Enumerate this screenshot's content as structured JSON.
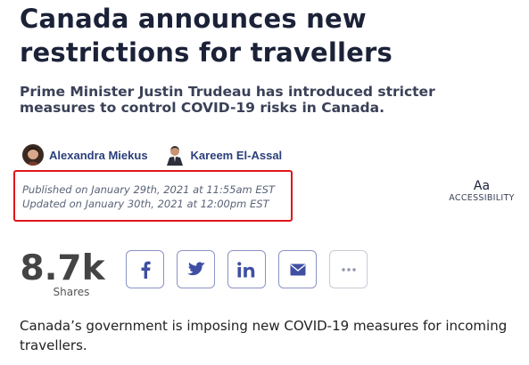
{
  "article": {
    "headline": "Canada announces new restrictions for travellers",
    "subheadline": "Prime Minister Justin Trudeau has introduced stricter measures to control COVID-19 risks in Canada.",
    "authors": [
      {
        "name": "Alexandra Miekus"
      },
      {
        "name": "Kareem El-Assal"
      }
    ],
    "published": "Published on January 29th, 2021 at 11:55am EST",
    "updated": "Updated on January 30th, 2021 at 12:00pm EST",
    "lead": "Canada’s government is imposing new COVID-19 measures for incoming travellers."
  },
  "accessibility": {
    "aa": "Aa",
    "label": "ACCESSIBILITY"
  },
  "shares": {
    "count": "8.7k",
    "label": "Shares",
    "buttons": [
      "facebook-icon",
      "twitter-icon",
      "linkedin-icon",
      "email-icon",
      "more-icon"
    ]
  },
  "colors": {
    "highlight_border": "#e0151b",
    "share_border": "#8b93c4",
    "author_link": "#2a3f7a"
  }
}
